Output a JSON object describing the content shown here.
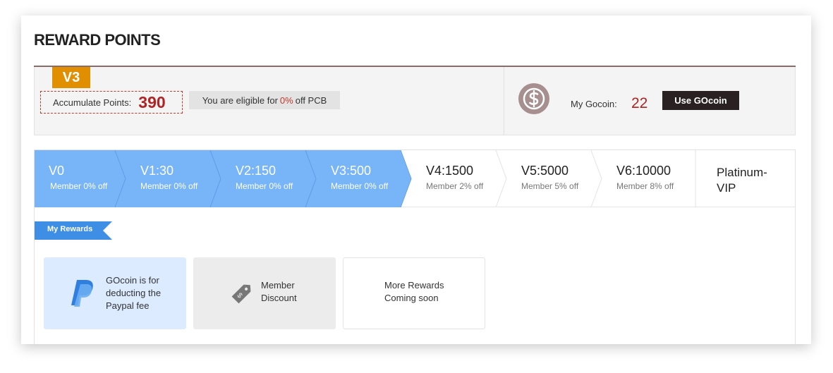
{
  "page": {
    "title": "REWARD POINTS"
  },
  "points": {
    "level_badge": "V3",
    "accumulate_label": "Accumulate Points:",
    "accumulate_value": "390",
    "eligible_prefix": "You are eligible for",
    "eligible_percent": "0%",
    "eligible_suffix": "off PCB"
  },
  "gocoin": {
    "label": "My Gocoin:",
    "value": "22",
    "button_label": "Use GOcoin",
    "icon": "dollar-coin-icon"
  },
  "levels": [
    {
      "title": "V0",
      "sub": "Member 0% off",
      "active": true
    },
    {
      "title": "V1:30",
      "sub": "Member 0% off",
      "active": true
    },
    {
      "title": "V2:150",
      "sub": "Member 0% off",
      "active": true
    },
    {
      "title": "V3:500",
      "sub": "Member 0% off",
      "active": true
    },
    {
      "title": "V4:1500",
      "sub": "Member 2% off",
      "active": false
    },
    {
      "title": "V5:5000",
      "sub": "Member 5% off",
      "active": false
    },
    {
      "title": "V6:10000",
      "sub": "Member 8% off",
      "active": false
    }
  ],
  "vip": {
    "line1": "Platinum-",
    "line2": "VIP"
  },
  "rewards": {
    "tag": "My Rewards",
    "items": [
      {
        "text": "GOcoin is for deducting the Paypal fee",
        "icon": "paypal-icon"
      },
      {
        "text": "Member Discount",
        "icon": "price-tag-icon"
      },
      {
        "text": "More Rewards Coming soon",
        "icon": ""
      }
    ]
  },
  "colors": {
    "active_level": "#78b4f8",
    "badge": "#e18f00",
    "accent_red": "#b22222",
    "dark_button": "#2a2222",
    "tag_blue": "#3f8ee6"
  }
}
